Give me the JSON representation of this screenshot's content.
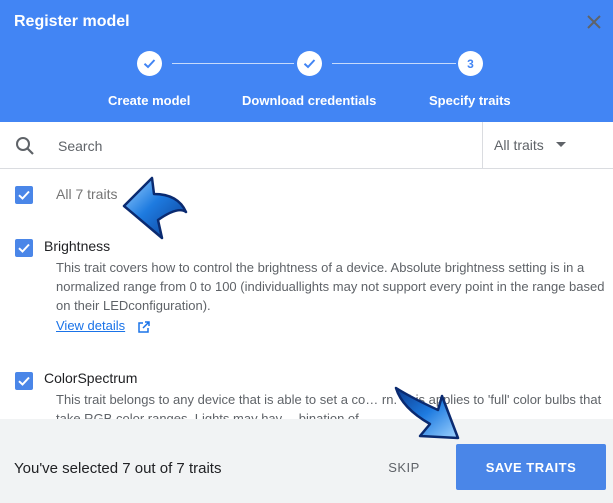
{
  "dialog": {
    "title": "Register model",
    "close_icon": "close-icon"
  },
  "stepper": {
    "steps": [
      {
        "label": "Create model",
        "state": "done",
        "icon": "check-icon"
      },
      {
        "label": "Download credentials",
        "state": "done",
        "icon": "check-icon"
      },
      {
        "label": "Specify traits",
        "state": "current",
        "number": "3"
      }
    ]
  },
  "search": {
    "placeholder": "Search",
    "value": "",
    "icon": "search-icon"
  },
  "filter": {
    "selected": "All traits",
    "icon": "caret-down-icon"
  },
  "select_all": {
    "label": "All 7 traits",
    "checked": true
  },
  "traits": [
    {
      "name": "Brightness",
      "checked": true,
      "description": "This trait covers how to control the brightness of a device. Absolute brightness setting is in a normalized range from 0 to 100 (individuallights may not support every point in the range based on their LEDconfiguration).",
      "link_label": "View details",
      "link_icon": "open-in-new-icon"
    },
    {
      "name": "ColorSpectrum",
      "checked": true,
      "description": "This trait belongs to any device that is able to set a co… rn. This applies to 'full' color bulbs that take RGB color ranges. Lights may hav… bination of"
    }
  ],
  "footer": {
    "status_text": "You've selected 7 out of 7 traits",
    "skip_label": "SKIP",
    "save_label": "SAVE TRAITS"
  },
  "colors": {
    "header": "#4285f4",
    "accent": "#4a86e8",
    "footer_bg": "#f1f3f4",
    "link": "#1a73e8"
  }
}
